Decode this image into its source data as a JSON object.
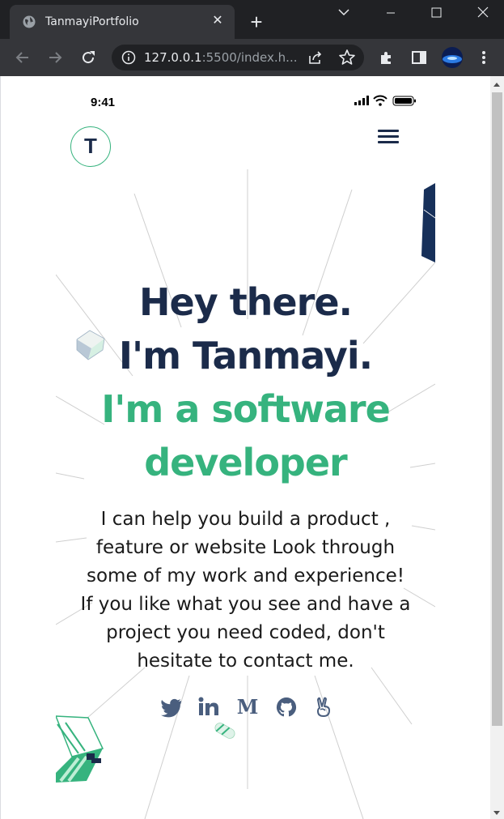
{
  "browser": {
    "tab_title": "TanmayiPortfolio",
    "tab_close": "✕",
    "new_tab": "+",
    "url_host": "127.0.0.1",
    "url_rest": ":5500/index.h..."
  },
  "phone": {
    "status_time": "9:41",
    "logo_letter": "T"
  },
  "hero": {
    "line1": "Hey there.",
    "line2": "I'm Tanmayi.",
    "line3": "I'm a software",
    "line4": "developer",
    "body": "I can help you build a product , feature or website Look through some of my work and experience! If you like what you see and have a project you need coded, don't hesitate to contact me."
  },
  "socials": [
    "twitter-icon",
    "linkedin-icon",
    "medium-icon",
    "github-icon",
    "angellist-icon"
  ],
  "colors": {
    "navy": "#1b2b4a",
    "green": "#36b37e",
    "chrome_dark": "#202124",
    "chrome_tab": "#35363a"
  }
}
